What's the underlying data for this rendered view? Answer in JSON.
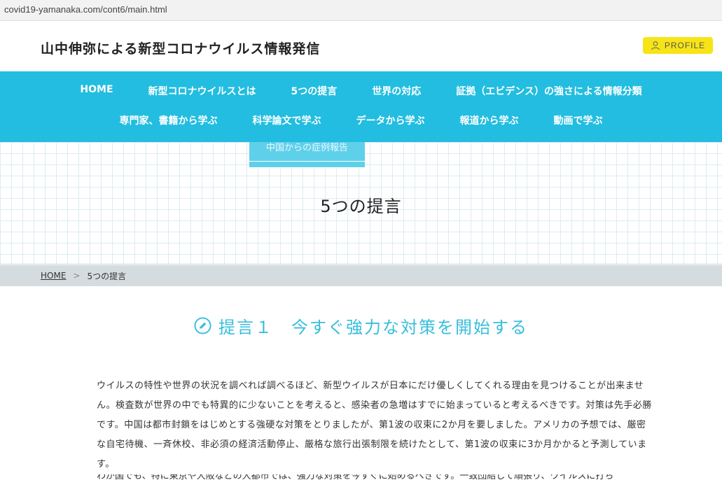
{
  "browser": {
    "url": "covid19-yamanaka.com/cont6/main.html"
  },
  "header": {
    "site_title": "山中伸弥による新型コロナウイルス情報発信",
    "profile_label": "PROFILE"
  },
  "nav": {
    "row1": [
      "HOME",
      "新型コロナウイルスとは",
      "5つの提言",
      "世界の対応",
      "証拠（エビデンス）の強さによる情報分類"
    ],
    "row2": [
      "専門家、書籍から学ぶ",
      "科学論文で学ぶ",
      "データから学ぶ",
      "報道から学ぶ",
      "動画で学ぶ"
    ]
  },
  "dropdown": {
    "item": "中国からの症例報告"
  },
  "hero": {
    "title": "5つの提言"
  },
  "breadcrumb": {
    "home": "HOME",
    "separator": ">",
    "current": "5つの提言"
  },
  "section": {
    "heading": "提言１　今すぐ強力な対策を開始する",
    "paragraph": "ウイルスの特性や世界の状況を調べれば調べるほど、新型ウイルスが日本にだけ優しくしてくれる理由を見つけることが出来ません。検査数が世界の中でも特異的に少ないことを考えると、感染者の急増はすでに始まっていると考えるべきです。対策は先手必勝です。中国は都市封鎖をはじめとする強硬な対策をとりましたが、第1波の収束に2か月を要しました。アメリカの予想では、厳密な自宅待機、一斉休校、非必須の経済活動停止、厳格な旅行出張制限を続けたとして、第1波の収束に3か月かかると予測しています。",
    "next_line_partial": "わが国でも、特に東京や大阪などの大都市では、強力な対策を今すぐに始めるべきです。一致団結して頑張り、ウイルスに打ち"
  },
  "colors": {
    "nav_bg": "#22bde0",
    "profile_bg": "#f7e417",
    "heading": "#37bedc",
    "breadcrumb_bg": "#d5dcdf"
  }
}
